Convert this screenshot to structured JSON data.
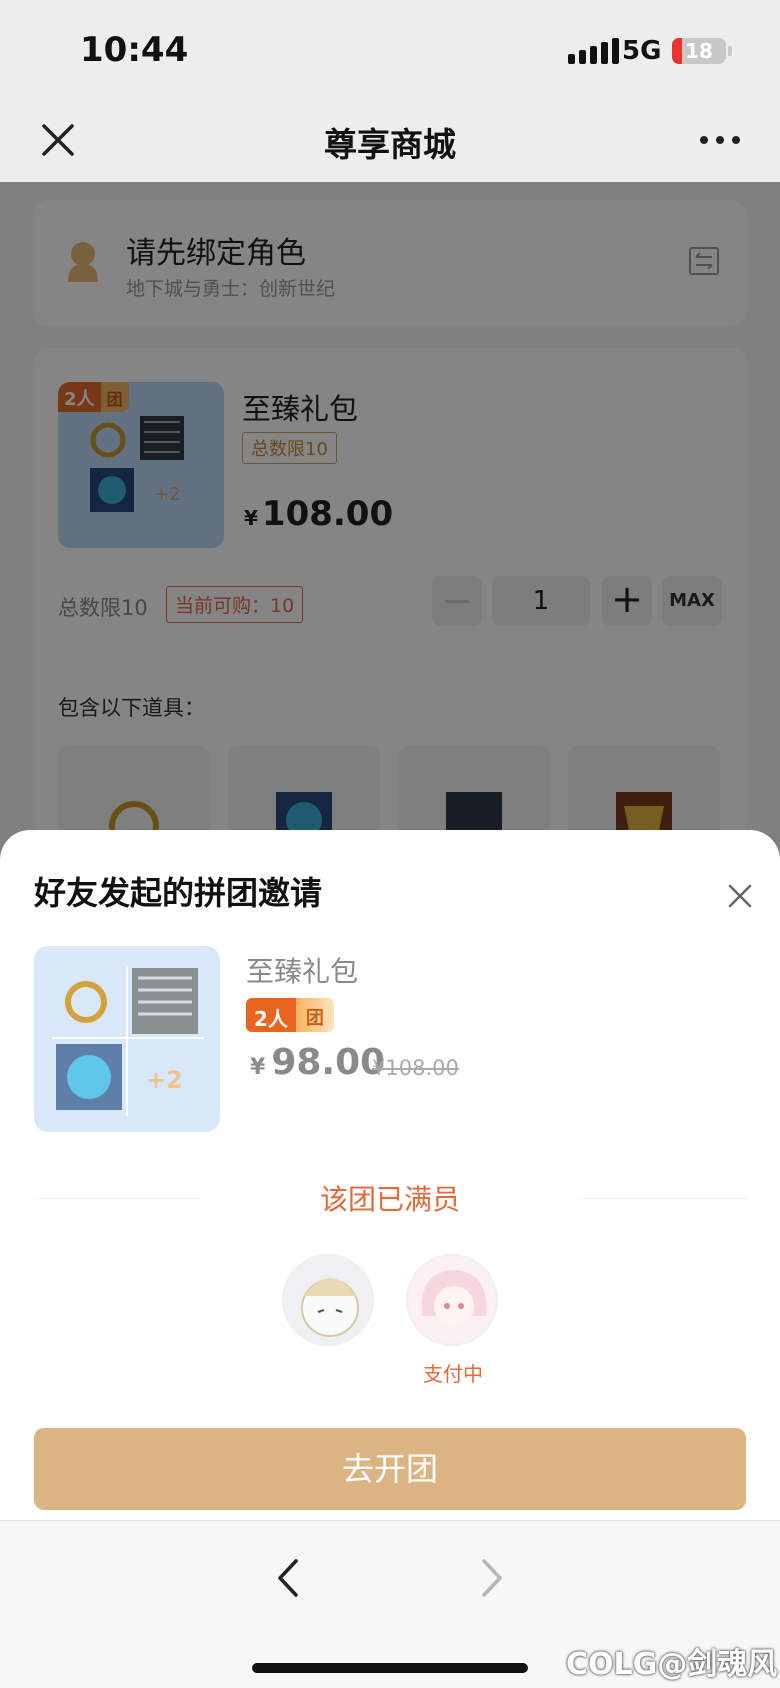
{
  "status_bar": {
    "time": "10:44",
    "network": "5G",
    "battery": "18",
    "battery_level": 0.18
  },
  "navbar": {
    "title": "尊享商城",
    "close_icon": "close-icon",
    "more_icon": "more-dots-icon"
  },
  "role_card": {
    "title": "请先绑定角色",
    "subtitle": "地下城与勇士：创新世纪"
  },
  "product": {
    "group_tag_a": "2人",
    "group_tag_b": "团",
    "name": "至臻礼包",
    "limit_badge": "总数限10",
    "currency": "¥",
    "price": "108.00",
    "limit_text": "总数限10",
    "can_buy": "当前可购：10",
    "quantity": "1",
    "max_label": "MAX",
    "thumb_more": "+2",
    "includes_label": "包含以下道具："
  },
  "sheet": {
    "title": "好友发起的拼团邀请",
    "product_name": "至臻礼包",
    "tag_a": "2人",
    "tag_b": "团",
    "currency": "¥",
    "price": "98.00",
    "original_price": "¥108.00",
    "thumb_more": "+2",
    "status": "该团已满员",
    "member_paying": "支付中",
    "button": "去开团"
  },
  "bottom_bar": {
    "watermark": "COLG@剑魂风"
  },
  "colors": {
    "accent": "#dcb484",
    "orange": "#e26a3b",
    "tag": "#e8651f"
  }
}
